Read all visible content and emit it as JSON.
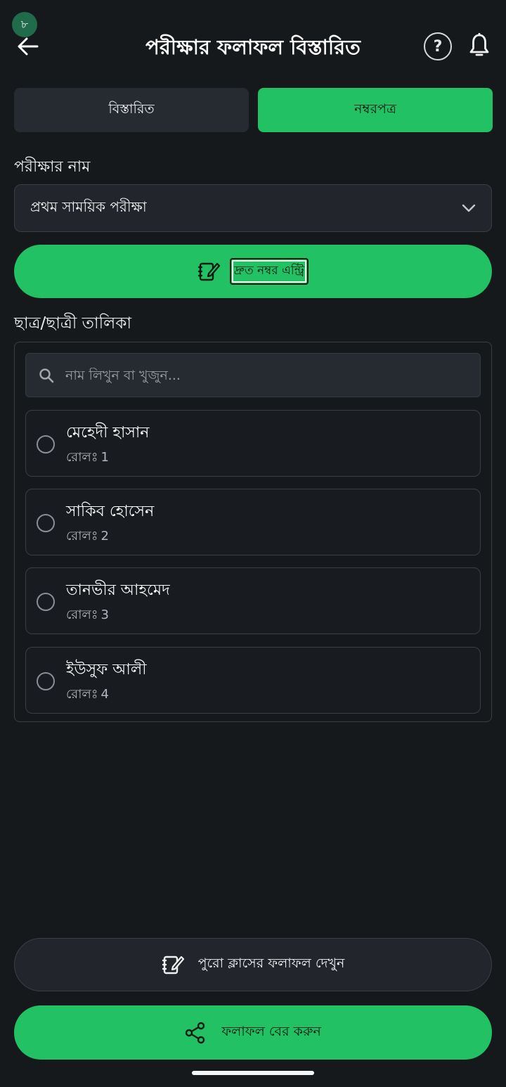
{
  "status": {
    "badge": "৮"
  },
  "header": {
    "title": "পরীক্ষার ফলাফল বিস্তারিত",
    "help_glyph": "?"
  },
  "tabs": [
    {
      "label": "বিস্তারিত",
      "active": false
    },
    {
      "label": "নম্বরপত্র",
      "active": true
    }
  ],
  "exam": {
    "label": "পরীক্ষার নাম",
    "selected": "প্রথম সাময়িক পরীক্ষা"
  },
  "quick_entry": {
    "label": "দ্রুত নম্বর এন্ট্রি"
  },
  "students": {
    "title": "ছাত্র/ছাত্রী তালিকা",
    "search_placeholder": "নাম লিখুন বা খুজুন...",
    "roll_label": "রোলঃ",
    "items": [
      {
        "name": "মেহেদী হাসান",
        "roll": "1"
      },
      {
        "name": "সাকিব হোসেন",
        "roll": "2"
      },
      {
        "name": "তানভীর আহমেদ",
        "roll": "3"
      },
      {
        "name": "ইউসুফ আলী",
        "roll": "4"
      }
    ]
  },
  "actions": {
    "class_results": "পুরো ক্লাসের ফলাফল দেখুন",
    "publish": "ফলাফল বের করুন"
  },
  "colors": {
    "accent": "#22c163",
    "background": "#16191c",
    "surface": "#22262c"
  },
  "icons": [
    "arrow-left-icon",
    "help-icon",
    "bell-icon",
    "chevron-down-icon",
    "notebook-edit-icon",
    "search-icon",
    "share-icon"
  ]
}
